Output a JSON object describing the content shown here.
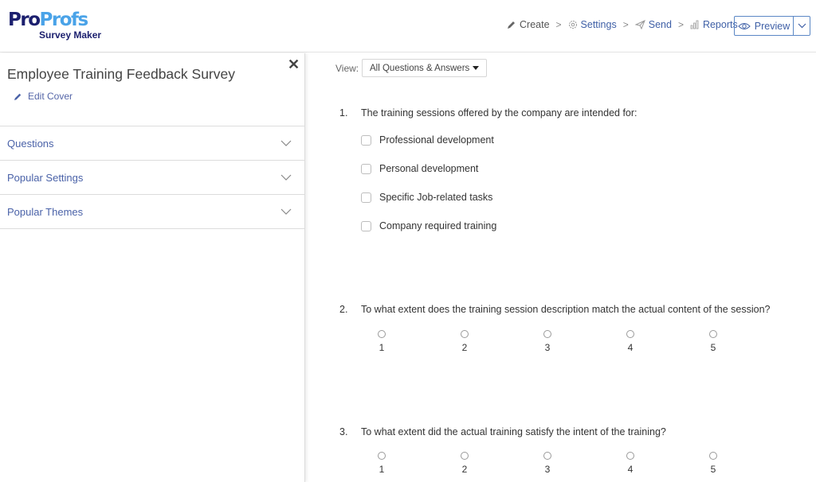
{
  "brand": {
    "pro": "Pro",
    "profs": "Profs",
    "sub": "Survey Maker"
  },
  "nav": {
    "items": [
      {
        "label": "Create",
        "icon": "pencil-icon"
      },
      {
        "label": "Settings",
        "icon": "gear-icon"
      },
      {
        "label": "Send",
        "icon": "paper-plane-icon"
      },
      {
        "label": "Reports",
        "icon": "bar-chart-icon"
      }
    ],
    "separator": ">",
    "preview_label": "Preview"
  },
  "sidebar": {
    "close": "✕",
    "title": "Employee Training Feedback Survey",
    "edit_cover": "Edit Cover",
    "sections": [
      {
        "label": "Questions"
      },
      {
        "label": "Popular Settings"
      },
      {
        "label": "Popular Themes"
      }
    ]
  },
  "main": {
    "view_label": "View:",
    "view_selected": "All Questions & Answers",
    "questions": [
      {
        "number": "1.",
        "text": "The training sessions offered by the company are intended for:",
        "type": "checkbox",
        "options": [
          "Professional development",
          "Personal development",
          "Specific Job-related tasks",
          "Company required training"
        ]
      },
      {
        "number": "2.",
        "text": "To what extent does the training session description match the actual content of the session?",
        "type": "scale",
        "options": [
          "1",
          "2",
          "3",
          "4",
          "5"
        ]
      },
      {
        "number": "3.",
        "text": "To what extent did the actual training satisfy the intent of the training?",
        "type": "scale",
        "options": [
          "1",
          "2",
          "3",
          "4",
          "5"
        ]
      }
    ]
  },
  "colors": {
    "brand_dark": "#1b1f6e",
    "brand_light": "#4aa3e8",
    "link": "#3e5fa6"
  }
}
